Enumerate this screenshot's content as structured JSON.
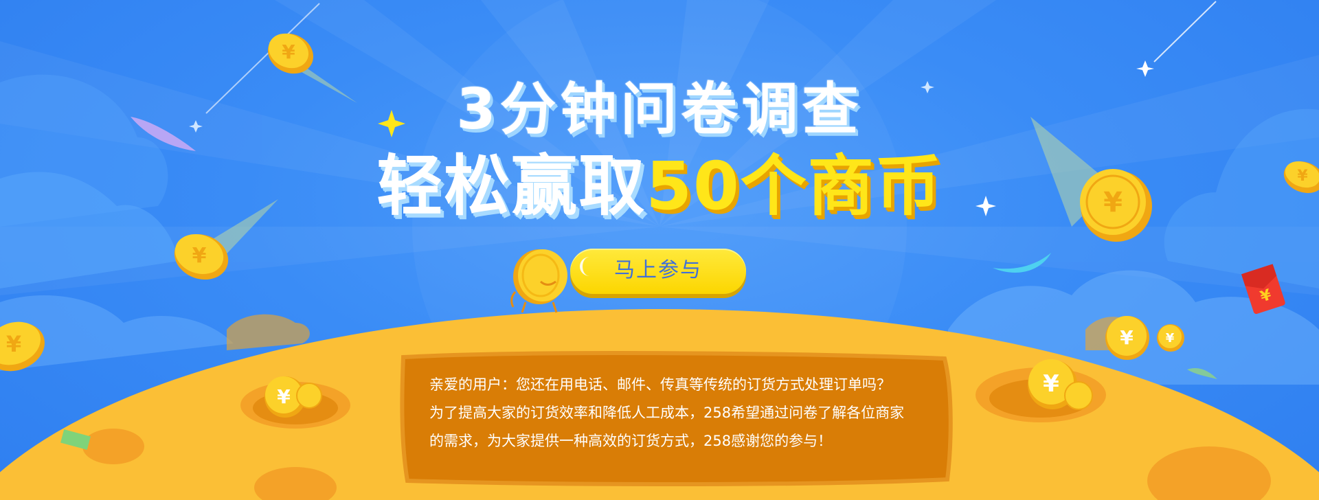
{
  "banner": {
    "title_line1": "3分钟问卷调查",
    "title_line2_a": "轻松赢取",
    "title_line2_b": "50个商币",
    "cta_label": "马上参与",
    "intro": {
      "line1": "亲爱的用户：您还在用电话、邮件、传真等传统的订货方式处理订单吗？",
      "line2": "为了提高大家的订货效率和降低人工成本，258希望通过问卷了解各位商家",
      "line3": "的需求，为大家提供一种高效的订货方式，258感谢您的参与！"
    },
    "coin_symbol": "¥",
    "colors": {
      "sky": "#3a8cf6",
      "ground": "#fbbf36",
      "box": "#d97d06",
      "highlight": "#ffe619",
      "button": "#fcd600",
      "button_text": "#3f6fd9"
    }
  }
}
